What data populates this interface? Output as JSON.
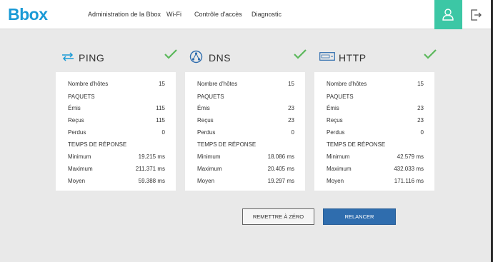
{
  "header": {
    "logo": "Bbox",
    "nav": [
      "Administration de la Bbox",
      "Wi-Fi",
      "Contrôle d'accès",
      "Diagnostic"
    ]
  },
  "accent_color": "#3cc7a5",
  "brand_color": "#1a9ad6",
  "sections": [
    {
      "title": "PING",
      "icon": "ping-arrows-icon",
      "status": "ok",
      "hosts_label": "Nombre d'hôtes",
      "hosts": "15",
      "packets_label": "PAQUETS",
      "sent_label": "Émis",
      "sent": "115",
      "received_label": "Reçus",
      "received": "115",
      "lost_label": "Perdus",
      "lost": "0",
      "response_label": "TEMPS DE RÉPONSE",
      "min_label": "Minimum",
      "min": "19.215 ms",
      "max_label": "Maximum",
      "max": "211.371 ms",
      "avg_label": "Moyen",
      "avg": "59.388 ms"
    },
    {
      "title": "DNS",
      "icon": "dns-network-icon",
      "status": "ok",
      "hosts_label": "Nombre d'hôtes",
      "hosts": "15",
      "packets_label": "PAQUETS",
      "sent_label": "Émis",
      "sent": "23",
      "received_label": "Reçus",
      "received": "23",
      "lost_label": "Perdus",
      "lost": "0",
      "response_label": "TEMPS DE RÉPONSE",
      "min_label": "Minimum",
      "min": "18.086 ms",
      "max_label": "Maximum",
      "max": "20.405 ms",
      "avg_label": "Moyen",
      "avg": "19.297 ms"
    },
    {
      "title": "HTTP",
      "icon": "http-browser-icon",
      "status": "ok",
      "hosts_label": "Nombre d'hôtes",
      "hosts": "15",
      "packets_label": "PAQUETS",
      "sent_label": "Émis",
      "sent": "23",
      "received_label": "Reçus",
      "received": "23",
      "lost_label": "Perdus",
      "lost": "0",
      "response_label": "TEMPS DE RÉPONSE",
      "min_label": "Minimum",
      "min": "42.579 ms",
      "max_label": "Maximum",
      "max": "432.033 ms",
      "avg_label": "Moyen",
      "avg": "171.116 ms"
    }
  ],
  "actions": {
    "reset_label": "REMETTRE À ZÉRO",
    "relaunch_label": "RELANCER"
  }
}
